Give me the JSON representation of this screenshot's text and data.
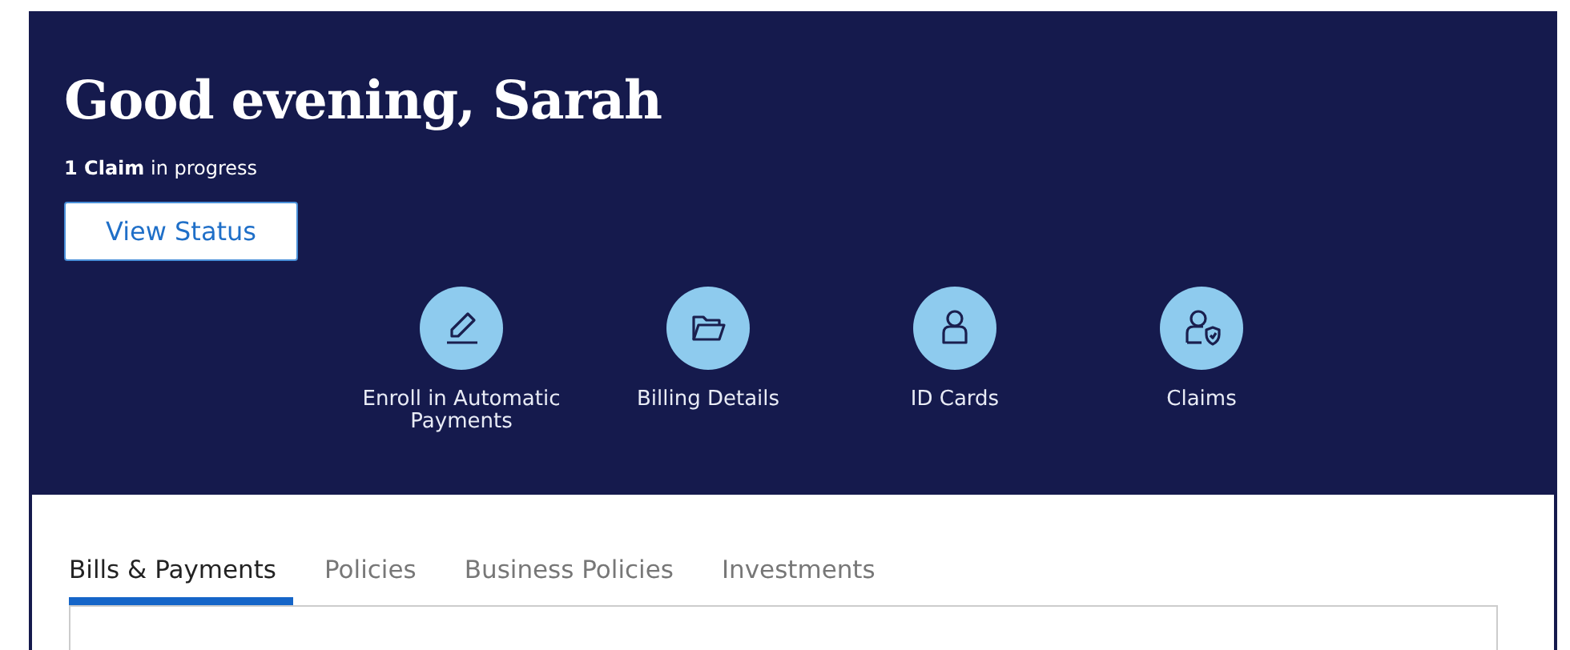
{
  "greeting": "Good evening, Sarah",
  "status_line": "**1 Claim** in progress",
  "status_button": "View Status",
  "quick_actions": [
    {
      "kind": "pencil",
      "label": "Enroll in Automatic Payments"
    },
    {
      "kind": "folder",
      "label": "Billing Details"
    },
    {
      "kind": "person",
      "label": "ID Cards"
    },
    {
      "kind": "shield-person",
      "label": "Claims"
    }
  ],
  "tabs": [
    {
      "label": "Bills & Payments",
      "selected": true
    },
    {
      "label": "Policies",
      "selected": false
    },
    {
      "label": "Business Policies",
      "selected": false
    },
    {
      "label": "Investments",
      "selected": false
    }
  ]
}
